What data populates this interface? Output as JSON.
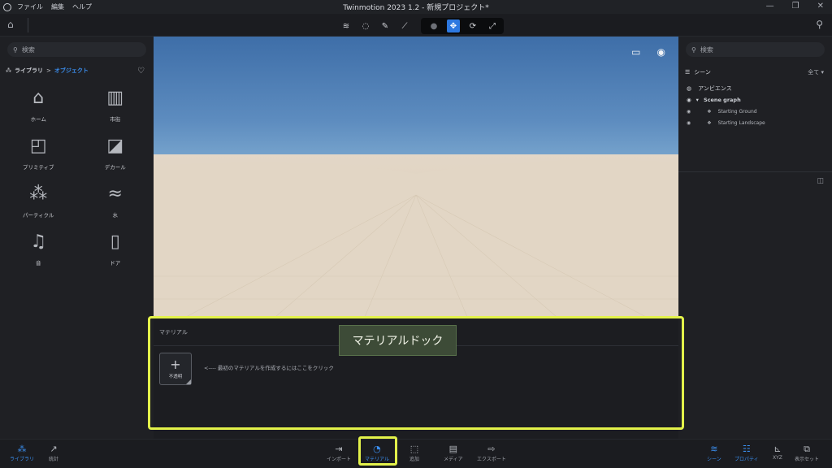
{
  "window": {
    "title": "Twinmotion 2023 1.2 - 新規プロジェクト*",
    "menu": [
      "ファイル",
      "編集",
      "ヘルプ"
    ]
  },
  "library": {
    "search_placeholder": "検索",
    "crumb_library": "ライブラリ",
    "crumb_separator": ">",
    "crumb_objects": "オブジェクト",
    "items": [
      {
        "label": "ホーム",
        "icon": "house-icon"
      },
      {
        "label": "市街",
        "icon": "city-icon"
      },
      {
        "label": "プリミティブ",
        "icon": "primitive-icon"
      },
      {
        "label": "デカール",
        "icon": "decal-icon"
      },
      {
        "label": "パーティクル",
        "icon": "particle-icon"
      },
      {
        "label": "水",
        "icon": "water-icon"
      },
      {
        "label": "音",
        "icon": "music-icon"
      },
      {
        "label": "ドア",
        "icon": "door-icon"
      }
    ]
  },
  "scene": {
    "search_placeholder": "検索",
    "title": "シーン",
    "filter": "全て",
    "ambience": "アンビエンス",
    "graph": "Scene graph",
    "children": [
      "Starting Ground",
      "Starting Landscape"
    ]
  },
  "dock": {
    "title": "マテリアル",
    "new_material_label": "不透明",
    "hint": "<---- 最初のマテリアルを作成するにはここをクリック",
    "callout": "マテリアルドック"
  },
  "bottom": {
    "left": [
      {
        "label": "ライブラリ",
        "icon": "library-icon",
        "active": true
      },
      {
        "label": "統計",
        "icon": "stats-icon",
        "active": false
      }
    ],
    "center": [
      {
        "label": "インポート",
        "icon": "import-icon",
        "active": false
      },
      {
        "label": "マテリアル",
        "icon": "material-icon",
        "active": true
      },
      {
        "label": "追加",
        "icon": "add-icon",
        "active": false
      },
      {
        "label": "メディア",
        "icon": "media-icon",
        "active": false
      },
      {
        "label": "エクスポート",
        "icon": "export-icon",
        "active": false
      }
    ],
    "right": [
      {
        "label": "シーン",
        "icon": "scene-icon",
        "active": true
      },
      {
        "label": "プロパティ",
        "icon": "properties-icon",
        "active": true
      },
      {
        "label": "XYZ",
        "icon": "xyz-icon",
        "active": false
      },
      {
        "label": "表示セット",
        "icon": "display-set-icon",
        "active": false
      }
    ]
  },
  "colors": {
    "accent": "#3b8ff0",
    "highlight": "#e3f24a",
    "panel": "#1f2024"
  }
}
